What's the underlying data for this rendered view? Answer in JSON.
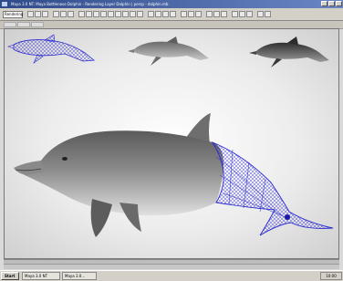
{
  "window": {
    "title": "Maya 3.0 NT: Maya Bottlenose Dolphin - Rendering Layer Dolphin | persp - dolphin.mb"
  },
  "toolbar": {
    "mode_dropdown": "Rendering"
  },
  "taskbar": {
    "start_label": "Start",
    "tasks": [
      "Maya 3.0 NT",
      "Maya 3.0..."
    ],
    "clock": "10:00"
  },
  "viewport": {
    "background": "#e6e6e6",
    "wireframe_color": "#2a2ad0"
  }
}
